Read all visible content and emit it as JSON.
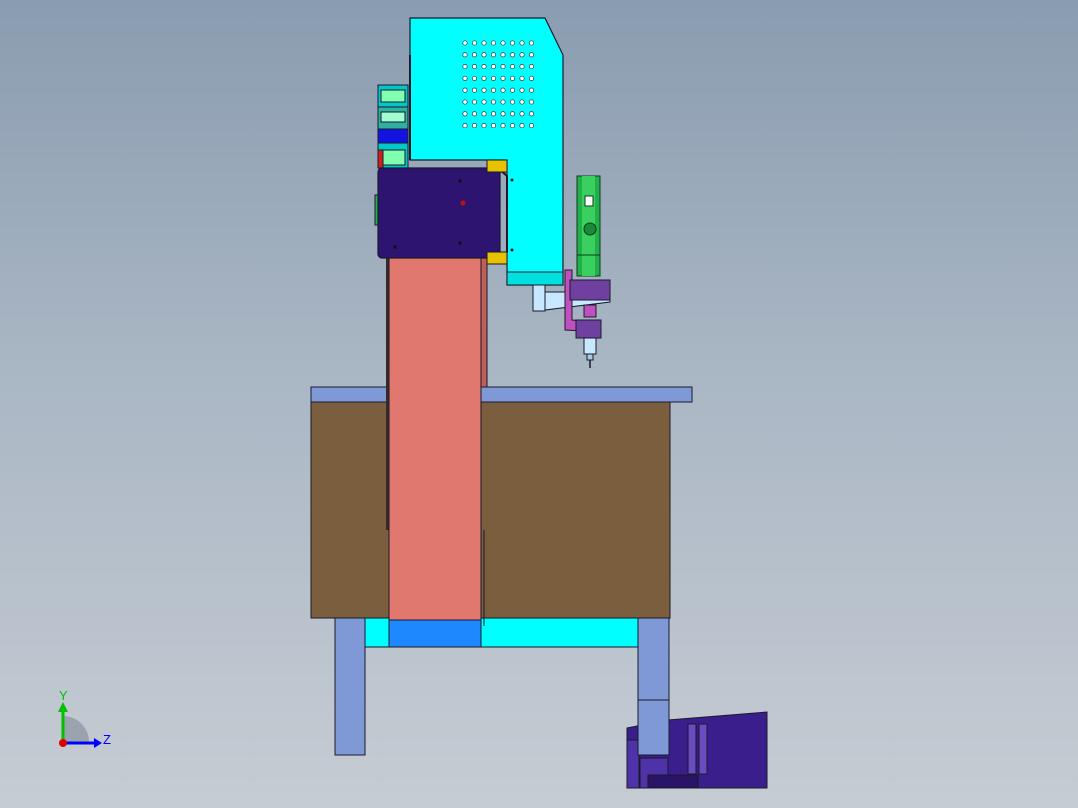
{
  "viewport": {
    "background_top": "#8a9cb0",
    "background_bottom": "#c6ccd3"
  },
  "model": {
    "parts": [
      {
        "name": "press-head-housing",
        "color": "#00ffff"
      },
      {
        "name": "carriage-plate",
        "color": "#2d1470"
      },
      {
        "name": "column",
        "color": "#e07870"
      },
      {
        "name": "table-top",
        "color": "#7f99d6"
      },
      {
        "name": "cabinet",
        "color": "#7a5e3e"
      },
      {
        "name": "under-frame",
        "color": "#00ffff"
      },
      {
        "name": "legs",
        "color": "#7f99d6"
      },
      {
        "name": "servo-spindle",
        "color": "#22b04a"
      },
      {
        "name": "tool-arm",
        "color": "#b06cc0"
      },
      {
        "name": "foot-pedal",
        "color": "#3a1f8c"
      }
    ]
  },
  "triad": {
    "y_label": "Y",
    "z_label": "Z",
    "y_color": "#00c000",
    "z_color": "#0000ff",
    "x_color": "#e00000"
  }
}
